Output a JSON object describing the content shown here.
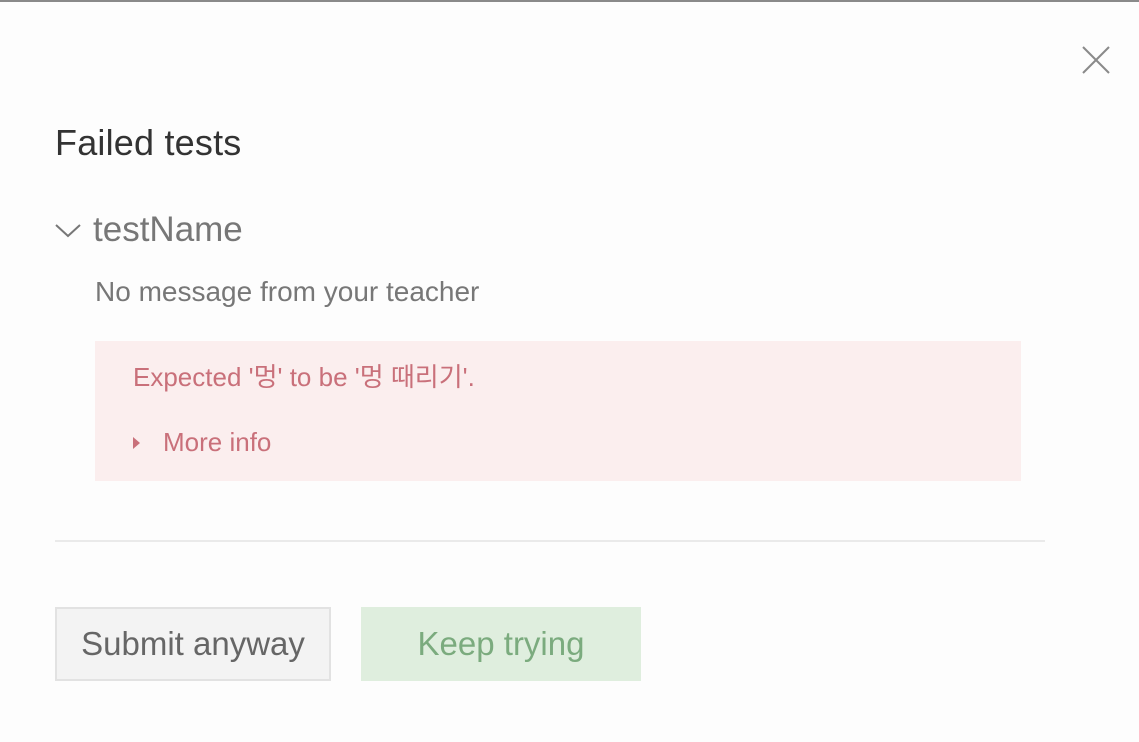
{
  "dialog": {
    "title": "Failed tests",
    "close_icon": "close-icon"
  },
  "test": {
    "name": "testName",
    "expand_icon": "chevron-down-icon",
    "teacher_message": "No message from your teacher",
    "error": {
      "message": "Expected '멍' to be '멍 때리기'.",
      "more_info_label": "More info",
      "more_info_icon": "caret-right-icon"
    }
  },
  "buttons": {
    "submit_anyway": "Submit anyway",
    "keep_trying": "Keep trying"
  },
  "colors": {
    "error_background": "#fbeeee",
    "error_text": "#c9707a",
    "keep_trying_background": "#dfeede",
    "keep_trying_text": "#7bab7e",
    "submit_background": "#f3f3f3"
  }
}
